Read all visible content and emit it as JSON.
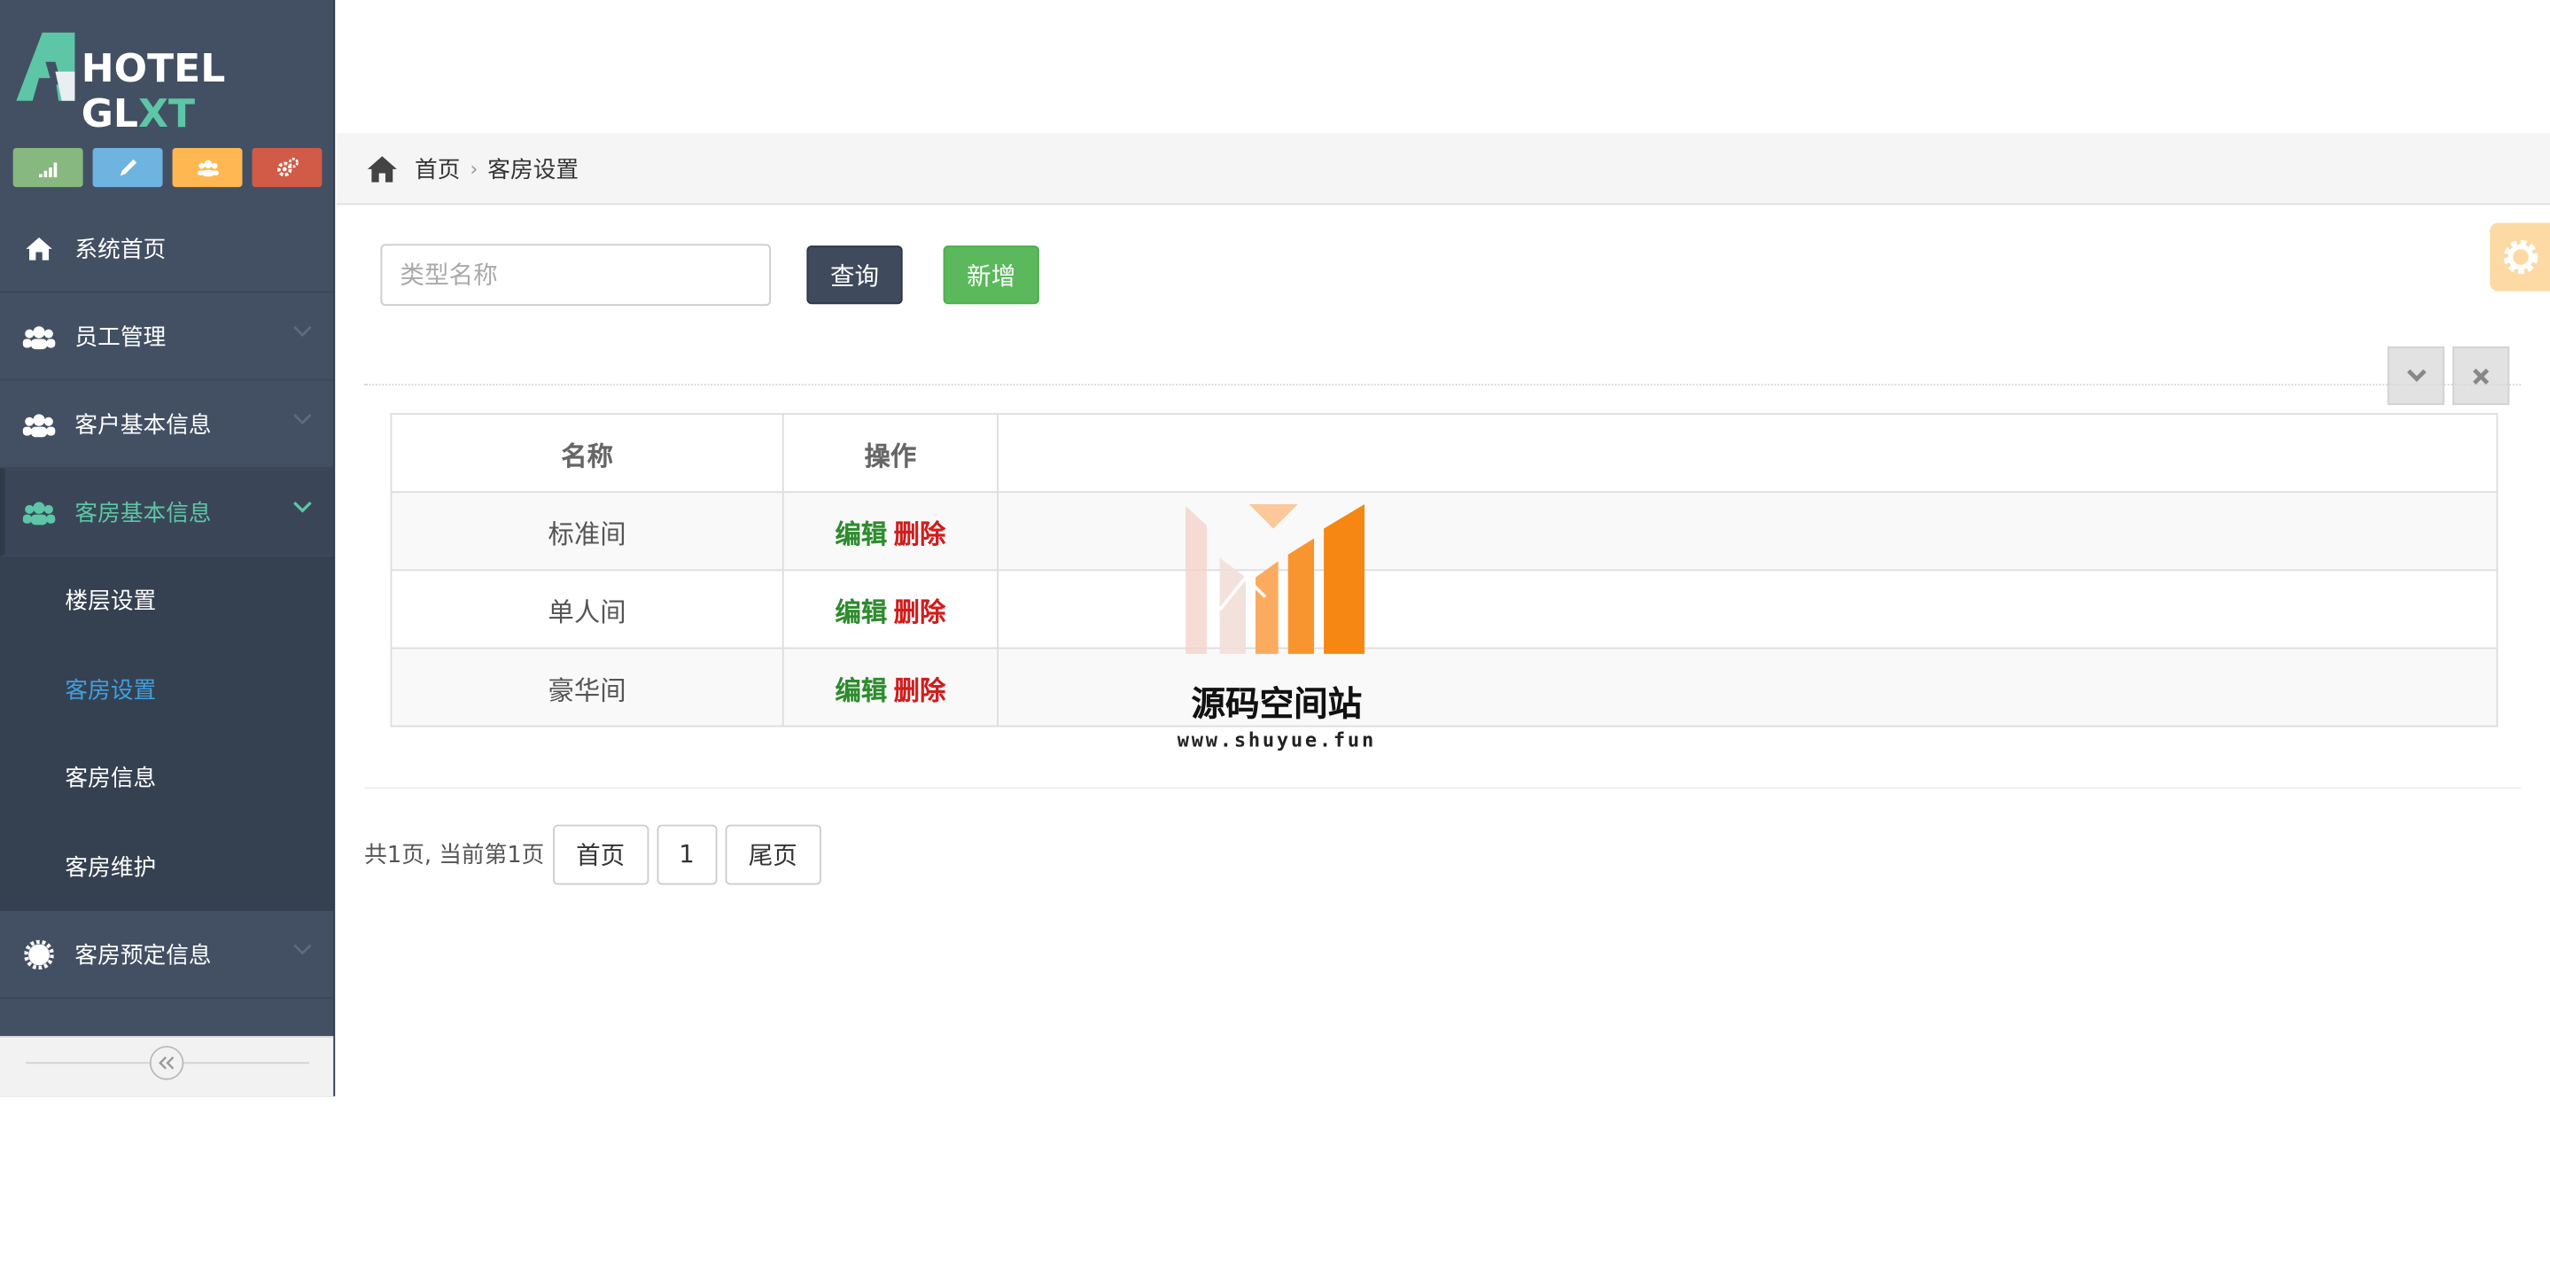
{
  "app": {
    "logo_prefix": "HOTEL GL",
    "logo_accent": "XT"
  },
  "colors": {
    "sidebar_bg": "#435063",
    "accent_green": "#5cc6a6",
    "active_blue": "#3fa0e0",
    "query_btn": "#3f4a5c",
    "add_btn": "#5cb85c",
    "edit_link": "#2e8b2e",
    "delete_link": "#d01d1d"
  },
  "shortcuts": [
    {
      "icon": "signal-icon",
      "color": "#87b87f"
    },
    {
      "icon": "pencil-icon",
      "color": "#6fb3e0"
    },
    {
      "icon": "users-icon",
      "color": "#ffb752"
    },
    {
      "icon": "cogs-icon",
      "color": "#d15b47"
    }
  ],
  "sidebar": {
    "items": [
      {
        "label": "系统首页",
        "icon": "home-icon"
      },
      {
        "label": "员工管理",
        "icon": "users-icon"
      },
      {
        "label": "客户基本信息",
        "icon": "users-icon"
      },
      {
        "label": "客房基本信息",
        "icon": "users-icon"
      },
      {
        "label": "客房预定信息",
        "icon": "gear-icon"
      }
    ],
    "submenu": [
      {
        "label": "楼层设置"
      },
      {
        "label": "客房设置"
      },
      {
        "label": "客房信息"
      },
      {
        "label": "客房维护"
      }
    ]
  },
  "breadcrumb": {
    "home": "首页",
    "current": "客房设置"
  },
  "search": {
    "placeholder": "类型名称",
    "query_label": "查询",
    "add_label": "新增"
  },
  "table": {
    "headers": [
      "名称",
      "操作"
    ],
    "rows": [
      {
        "name": "标准间",
        "edit": "编辑",
        "delete": "删除"
      },
      {
        "name": "单人间",
        "edit": "编辑",
        "delete": "删除"
      },
      {
        "name": "豪华间",
        "edit": "编辑",
        "delete": "删除"
      }
    ]
  },
  "watermark": {
    "title": "源码空间站",
    "url": "www.shuyue.fun"
  },
  "pagination": {
    "info": "共1页, 当前第1页",
    "first": "首页",
    "page": "1",
    "last": "尾页"
  }
}
